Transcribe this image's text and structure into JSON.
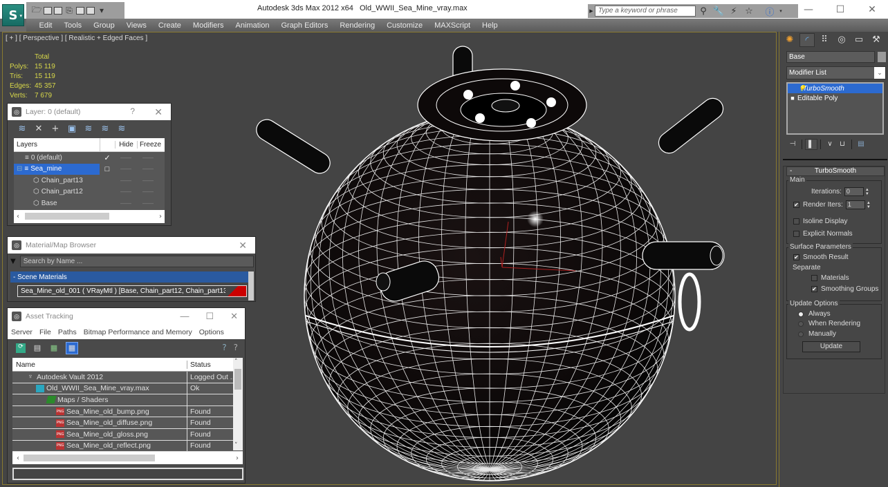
{
  "window": {
    "app_title": "Autodesk 3ds Max  2012 x64",
    "file_name": "Old_WWII_Sea_Mine_vray.max",
    "search_placeholder": "Type a keyword or phrase",
    "controls": {
      "minimize": "—",
      "maximize": "☐",
      "close": "✕"
    }
  },
  "menu": [
    "Edit",
    "Tools",
    "Group",
    "Views",
    "Create",
    "Modifiers",
    "Animation",
    "Graph Editors",
    "Rendering",
    "Customize",
    "MAXScript",
    "Help"
  ],
  "viewport": {
    "label": "[ + ] [ Perspective ] [ Realistic + Edged Faces ]",
    "stats": {
      "header": "Total",
      "rows": [
        {
          "key": "Polys:",
          "value": "15 119"
        },
        {
          "key": "Tris:",
          "value": "15 119"
        },
        {
          "key": "Edges:",
          "value": "45 357"
        },
        {
          "key": "Verts:",
          "value": "7 679"
        }
      ]
    }
  },
  "layer_panel": {
    "title": "Layer: 0 (default)",
    "help": "?",
    "close": "✕",
    "columns": {
      "layers": "Layers",
      "hide": "Hide",
      "freeze": "Freeze"
    },
    "rows": [
      {
        "name": "0 (default)",
        "icon": "layer-icon",
        "indent": 1,
        "selected": false,
        "check": "✓"
      },
      {
        "name": "Sea_mine",
        "icon": "layer-icon",
        "indent": 1,
        "selected": true,
        "check": "□"
      },
      {
        "name": "Chain_part13",
        "icon": "object-icon",
        "indent": 2,
        "selected": false,
        "check": ""
      },
      {
        "name": "Chain_part12",
        "icon": "object-icon",
        "indent": 2,
        "selected": false,
        "check": ""
      },
      {
        "name": "Base",
        "icon": "object-icon",
        "indent": 2,
        "selected": false,
        "check": ""
      }
    ],
    "dash": "——"
  },
  "material_browser": {
    "title": "Material/Map Browser",
    "close": "✕",
    "search_placeholder": "Search by Name ...",
    "section": "- Scene Materials",
    "item": "Sea_Mine_old_001  ( VRayMtl ) [Base, Chain_part12, Chain_part13]",
    "swatch_color": "#cc0000"
  },
  "asset_tracking": {
    "title": "Asset Tracking",
    "menu": [
      "Server",
      "File",
      "Paths",
      "Bitmap Performance and Memory",
      "Options"
    ],
    "columns": {
      "name": "Name",
      "status": "Status"
    },
    "rows": [
      {
        "name": "Autodesk Vault 2012",
        "status": "Logged Out ...",
        "icon": "vault-icon",
        "indent": 1
      },
      {
        "name": "Old_WWII_Sea_Mine_vray.max",
        "status": "Ok",
        "icon": "max-file-icon",
        "indent": 2
      },
      {
        "name": "Maps / Shaders",
        "status": "",
        "icon": "maps-icon",
        "indent": 3
      },
      {
        "name": "Sea_Mine_old_bump.png",
        "status": "Found",
        "icon": "png-icon",
        "indent": 4
      },
      {
        "name": "Sea_Mine_old_diffuse.png",
        "status": "Found",
        "icon": "png-icon",
        "indent": 4
      },
      {
        "name": "Sea_Mine_old_gloss.png",
        "status": "Found",
        "icon": "png-icon",
        "indent": 4
      },
      {
        "name": "Sea_Mine_old_reflect.png",
        "status": "Found",
        "icon": "png-icon",
        "indent": 4
      }
    ],
    "path_value": ""
  },
  "command_panel": {
    "object_name": "Base",
    "object_color": "#9a9a9a",
    "modifier_list": "Modifier List",
    "stack": [
      {
        "name": "TurboSmooth",
        "selected": true
      },
      {
        "name": "Editable Poly",
        "selected": false
      }
    ],
    "turbosmooth": {
      "title": "TurboSmooth",
      "main_label": "Main",
      "iterations_label": "Iterations:",
      "iterations_value": "0",
      "render_iters_label": "Render Iters:",
      "render_iters_value": "1",
      "render_iters_checked": true,
      "isoline_label": "Isoline Display",
      "isoline_checked": false,
      "explicit_normals_label": "Explicit Normals",
      "explicit_normals_checked": false,
      "surface_label": "Surface Parameters",
      "smooth_result_label": "Smooth Result",
      "smooth_result_checked": true,
      "separate_label": "Separate",
      "materials_label": "Materials",
      "materials_checked": false,
      "smoothing_groups_label": "Smoothing Groups",
      "smoothing_groups_checked": true,
      "update_options_label": "Update Options",
      "update_options": [
        "Always",
        "When Rendering",
        "Manually"
      ],
      "update_selected": "Always",
      "update_button": "Update"
    }
  },
  "colors": {
    "viewport_bg": "#444444",
    "stats_text": "#d8d84a",
    "selection_blue": "#2c6ad0",
    "viewport_border": "#8a7a30"
  }
}
